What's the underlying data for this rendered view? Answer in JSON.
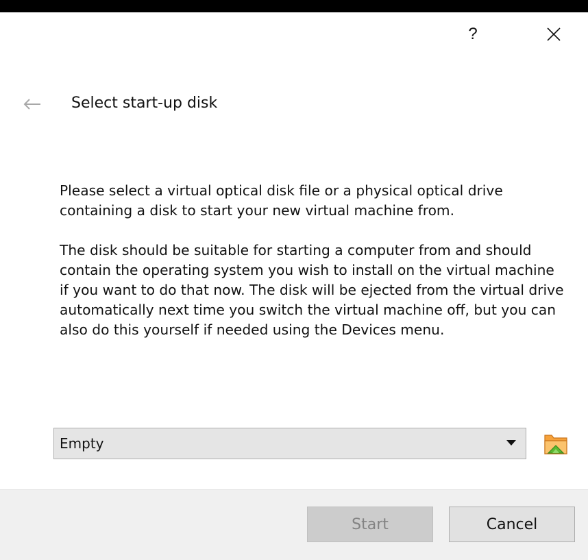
{
  "titlebar": {
    "help_label": "?",
    "help_icon": "question-mark-icon",
    "close_icon": "close-icon"
  },
  "header": {
    "back_icon": "back-arrow-icon",
    "title": "Select start-up disk"
  },
  "body": {
    "paragraph1": "Please select a virtual optical disk file or a physical optical drive containing a disk to start your new virtual machine from.",
    "paragraph2": "The disk should be suitable for starting a computer from and should contain the operating system you wish to install on the virtual machine if you want to do that now. The disk will be ejected from the virtual drive automatically next time you switch the virtual machine off, but you can also do this yourself if needed using the Devices menu."
  },
  "disk_selector": {
    "selected_value": "Empty",
    "arrow_icon": "dropdown-arrow-icon",
    "browse_icon": "folder-open-icon"
  },
  "buttons": {
    "start_label": "Start",
    "start_enabled": false,
    "cancel_label": "Cancel"
  },
  "colors": {
    "background": "#ffffff",
    "button_bar": "#f0f0f0",
    "combo_background": "#e5e5e5",
    "disabled_text": "#838383",
    "folder_orange": "#f6a23b",
    "folder_green": "#5cb932"
  }
}
